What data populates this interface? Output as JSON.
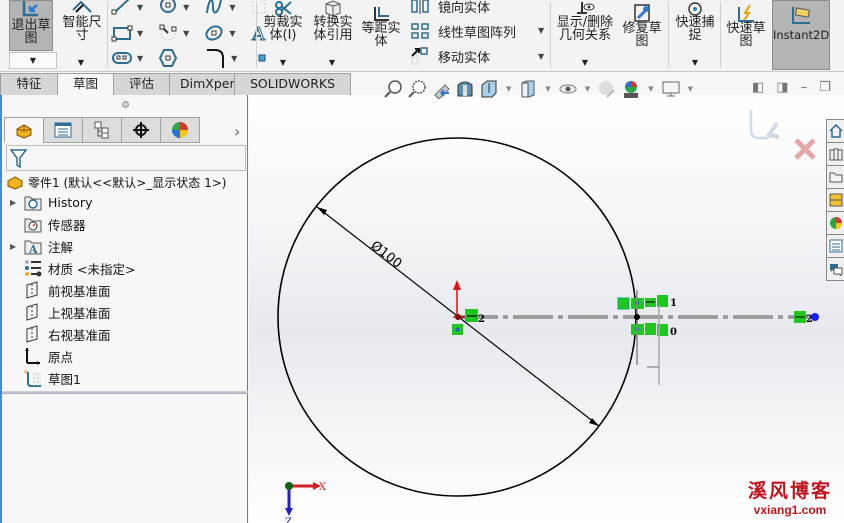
{
  "ribbon": {
    "exit_sketch": "退出草图",
    "smart_dimension": "智能尺寸",
    "trim_entities": "剪裁实体(T)",
    "trim_line1": "剪裁实",
    "trim_line2": "体(I)",
    "convert_line1": "转换实",
    "convert_line2": "体引用",
    "offset_line1": "等距实",
    "offset_line2": "体",
    "mirror_entities": "镜向实体",
    "linear_pattern": "线性草图阵列",
    "move_entities": "移动实体",
    "relations_line1": "显示/删除",
    "relations_line2": "几何关系",
    "repair_line1": "修复草",
    "repair_line2": "图",
    "quick_snaps_line1": "快速捕",
    "quick_snaps_line2": "捉",
    "rapid_sketch_line1": "快速草",
    "rapid_sketch_line2": "图",
    "instant2d": "Instant2D",
    "exit_line1": "退出草",
    "exit_line2": "图",
    "smart_line1": "智能尺",
    "smart_line2": "寸"
  },
  "tabs": [
    {
      "label": "特征",
      "active": false
    },
    {
      "label": "草图",
      "active": true
    },
    {
      "label": "评估",
      "active": false
    },
    {
      "label": "DimXpert",
      "active": false
    },
    {
      "label": "SOLIDWORKS 插件",
      "active": false
    }
  ],
  "feature_tree": {
    "root": "零件1  (默认<<默认>_显示状态 1>)",
    "items": [
      {
        "label": "History",
        "icon": "history-folder-icon",
        "expandable": true
      },
      {
        "label": "传感器",
        "icon": "sensor-folder-icon",
        "expandable": false
      },
      {
        "label": "注解",
        "icon": "annotation-folder-icon",
        "expandable": true
      },
      {
        "label": "材质 <未指定>",
        "icon": "material-icon",
        "expandable": false
      },
      {
        "label": "前视基准面",
        "icon": "plane-icon",
        "expandable": false
      },
      {
        "label": "上视基准面",
        "icon": "plane-icon",
        "expandable": false
      },
      {
        "label": "右视基准面",
        "icon": "plane-icon",
        "expandable": false
      },
      {
        "label": "原点",
        "icon": "origin-icon",
        "expandable": false
      },
      {
        "label": "草图1",
        "icon": "sketch-icon",
        "expandable": false
      }
    ]
  },
  "sketch": {
    "diameter_label": "Ø100",
    "relation_tags": [
      "2",
      "1",
      "0",
      "2"
    ],
    "triad_x": "X",
    "triad_z": "Z"
  },
  "watermark": {
    "title": "溪风博客",
    "url": "vxiang1.com"
  },
  "colors": {
    "accent_blue": "#3c8fd6",
    "relation_green": "#1ec81e",
    "dimension_line": "#000000",
    "watermark_red": "#c0141c"
  }
}
